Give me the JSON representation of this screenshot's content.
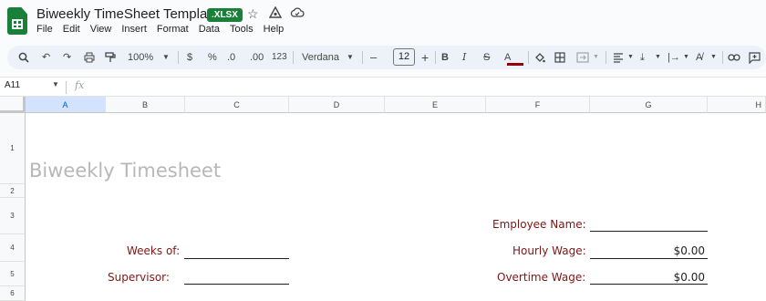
{
  "window": {
    "doc_title": "Biweekly TimeSheet Template",
    "file_badge": ".XLSX",
    "icons": [
      "star-icon",
      "move-to-folder-icon",
      "cloud-status-icon"
    ]
  },
  "menu": [
    "File",
    "Edit",
    "View",
    "Insert",
    "Format",
    "Data",
    "Tools",
    "Help"
  ],
  "toolbar": {
    "zoom": "100%",
    "currency": "$",
    "percent": "%",
    "decrease_decimal": ".0",
    "increase_decimal": ".00",
    "number_format": "123",
    "font": "Verdana",
    "font_size": "12",
    "minus": "–",
    "plus": "+",
    "bold": "B",
    "italic": "I",
    "strike": "S",
    "text_color_letter": "A",
    "text_color": "#980000"
  },
  "formula_bar": {
    "cell_ref": "A11",
    "fx": "fx",
    "value": ""
  },
  "grid": {
    "columns": [
      "A",
      "B",
      "C",
      "D",
      "E",
      "F",
      "G",
      "H"
    ],
    "selected_column": "A",
    "rows": [
      "1",
      "2",
      "3",
      "4",
      "5",
      "6"
    ]
  },
  "sheet": {
    "title": "Biweekly Timesheet",
    "weeks_of_label": "Weeks of:",
    "supervisor_label": "Supervisor:",
    "employee_name_label": "Employee Name:",
    "hourly_wage_label": "Hourly Wage:",
    "overtime_wage_label": "Overtime Wage:",
    "hourly_wage_value": "$0.00",
    "overtime_wage_value": "$0.00",
    "label_color": "#7f1515",
    "title_color": "#b7b7b7"
  }
}
